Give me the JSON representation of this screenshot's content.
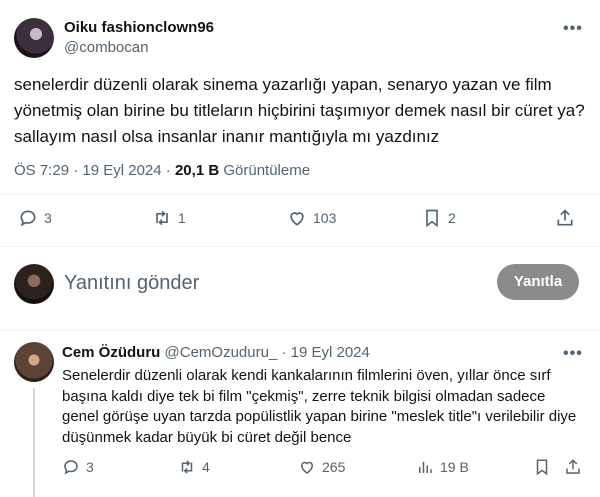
{
  "tweet": {
    "author_name": "Oiku fashionclown96",
    "handle": "@combocan",
    "text": "senelerdir düzenli olarak sinema yazarlığı yapan, senaryo yazan ve film yönetmiş olan birine bu titleların hiçbirini taşımıyor demek nasıl bir cüret ya? sallayım nasıl olsa insanlar inanır mantığıyla mı yazdınız",
    "time": "ÖS 7:29",
    "date": "19 Eyl 2024",
    "views_count": "20,1 B",
    "views_label": "Görüntüleme",
    "separator": "·",
    "replies": "3",
    "retweets": "1",
    "likes": "103",
    "bookmarks": "2"
  },
  "composer": {
    "placeholder": "Yanıtını gönder",
    "button_label": "Yanıtla"
  },
  "reply": {
    "author_name": "Cem Özüduru",
    "handle": "@CemOzuduru_",
    "separator": "·",
    "date": "19 Eyl 2024",
    "text": "Senelerdir düzenli olarak kendi kankalarının filmlerini öven,  yıllar önce sırf başına kaldı diye tek bi film \"çekmiş\", zerre teknik bilgisi olmadan sadece genel görüşe uyan tarzda popülistlik yapan birine \"meslek title\"ı verilebilir diye düşünmek kadar büyük bi cüret değil bence",
    "replies": "3",
    "retweets": "4",
    "likes": "265",
    "views": "19 B"
  },
  "icons": {
    "more": "more-dots-icon",
    "reply": "reply-bubble-icon",
    "retweet": "retweet-icon",
    "like": "heart-icon",
    "bookmark": "bookmark-icon",
    "share": "share-icon",
    "views": "views-chart-icon"
  },
  "colors": {
    "text": "#0f1419",
    "secondary": "#536471",
    "divider": "#eff3f4",
    "button": "#8b8b8b"
  }
}
